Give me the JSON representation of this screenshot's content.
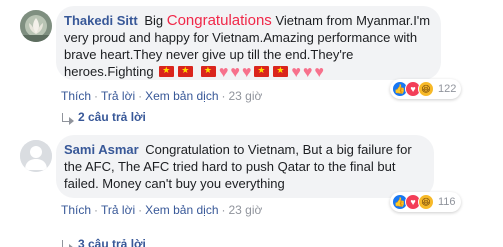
{
  "comments": [
    {
      "author": "Thakedi Sitt",
      "text_before": "Big",
      "highlight": "Congratulations",
      "text_after": "Vietnam from Myanmar.I'm very proud and happy for Vietnam.Amazing performance with brave heart.They never give up till the end.They're heroes.Fighting",
      "emoji_icons": [
        "vietnam-flag",
        "vietnam-flag",
        "vietnam-flag",
        "heart",
        "heart",
        "heart",
        "vietnam-flag",
        "vietnam-flag",
        "heart",
        "heart",
        "heart"
      ],
      "actions": {
        "like": "Thích",
        "reply": "Trả lời",
        "translate": "Xem bản dịch",
        "time": "23 giờ"
      },
      "reaction_count": "122",
      "reaction_icons": [
        "like-icon",
        "love-icon",
        "haha-icon"
      ],
      "replies_label": "2 câu trả lời"
    },
    {
      "author": "Sami Asmar",
      "text": "Congratulation to Vietnam, But a big failure for the AFC, The AFC tried hard to push Qatar to the final but failed. Money can't buy you everything",
      "actions": {
        "like": "Thích",
        "reply": "Trả lời",
        "translate": "Xem bản dịch",
        "time": "23 giờ"
      },
      "reaction_count": "116",
      "reaction_icons": [
        "like-icon",
        "love-icon",
        "haha-icon"
      ],
      "replies_label": "3 câu trả lời"
    }
  ],
  "colors": {
    "link": "#385898",
    "meta": "#90949c",
    "bubble": "#f2f3f5",
    "highlight": "#f02849",
    "like": "#1877f2",
    "love": "#f33e58",
    "haha": "#f7b928"
  }
}
